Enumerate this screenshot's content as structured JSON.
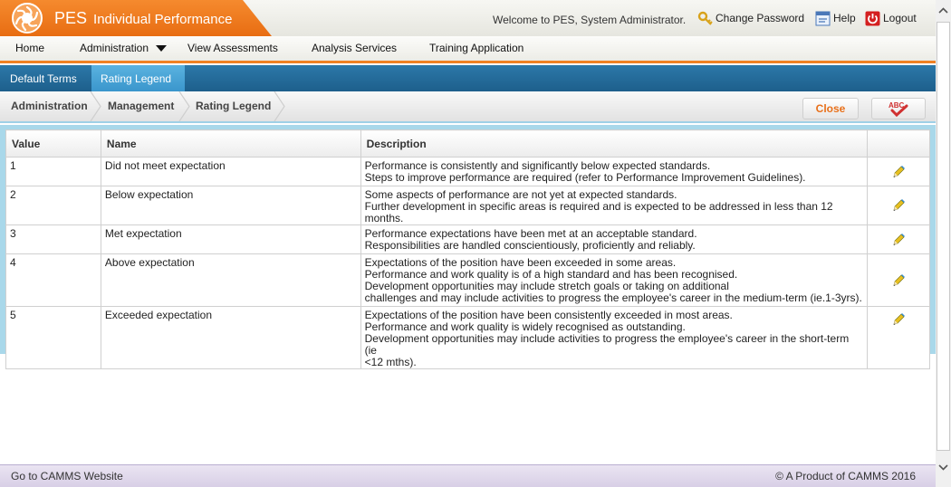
{
  "header": {
    "brand_title": "PES",
    "brand_subtitle": "Individual Performance",
    "welcome": "Welcome to PES, System Administrator.",
    "links": {
      "change_password": "Change Password",
      "help": "Help",
      "logout": "Logout"
    }
  },
  "nav": {
    "home": "Home",
    "administration": "Administration",
    "view_assessments": "View Assessments",
    "analysis_services": "Analysis Services",
    "training_application": "Training Application"
  },
  "tabs": {
    "default_terms": "Default Terms",
    "rating_legend": "Rating Legend"
  },
  "breadcrumb": {
    "items": [
      "Administration",
      "Management",
      "Rating Legend"
    ]
  },
  "actions": {
    "close": "Close",
    "spell_label": "ABC"
  },
  "table": {
    "headers": {
      "value": "Value",
      "name": "Name",
      "description": "Description"
    },
    "rows": [
      {
        "value": "1",
        "name": "Did not meet expectation",
        "description": [
          "Performance is consistently and significantly below expected standards.",
          "Steps to improve performance are required (refer to Performance Improvement Guidelines)."
        ]
      },
      {
        "value": "2",
        "name": "Below expectation",
        "description": [
          "Some aspects of performance are not yet at expected standards.",
          "Further development in specific areas is required and is expected to be addressed in less than 12 months."
        ]
      },
      {
        "value": "3",
        "name": "Met expectation",
        "description": [
          "Performance expectations have been met at an acceptable standard.",
          "Responsibilities are handled conscientiously, proficiently and reliably."
        ]
      },
      {
        "value": "4",
        "name": "Above expectation",
        "description": [
          "Expectations of the position have been exceeded in some areas.",
          "Performance and work quality is of a high standard and has been recognised.",
          "Development opportunities may include stretch goals or taking on additional",
          "challenges and may include activities to progress the employee's career in the medium-term (ie.1-3yrs)."
        ]
      },
      {
        "value": "5",
        "name": "Exceeded expectation",
        "description": [
          "Expectations of the position have been consistently exceeded in most areas.",
          "Performance and work quality is widely recognised as outstanding.",
          "Development opportunities may include activities to progress the employee's career in the short-term (ie",
          "<12 mths)."
        ]
      }
    ]
  },
  "footer": {
    "left": "Go to CAMMS Website",
    "right": "© A Product of CAMMS 2016"
  },
  "colors": {
    "brand_orange": "#e86d12",
    "tab_blue": "#1d5f8c",
    "tab_active": "#3a96cc",
    "content_bg": "#a9d8ea"
  },
  "icons": {
    "logo": "sun-logo-icon",
    "change_password": "key-icon",
    "help": "help-icon",
    "logout": "power-icon",
    "edit": "pencil-icon",
    "spell": "spellcheck-icon"
  }
}
